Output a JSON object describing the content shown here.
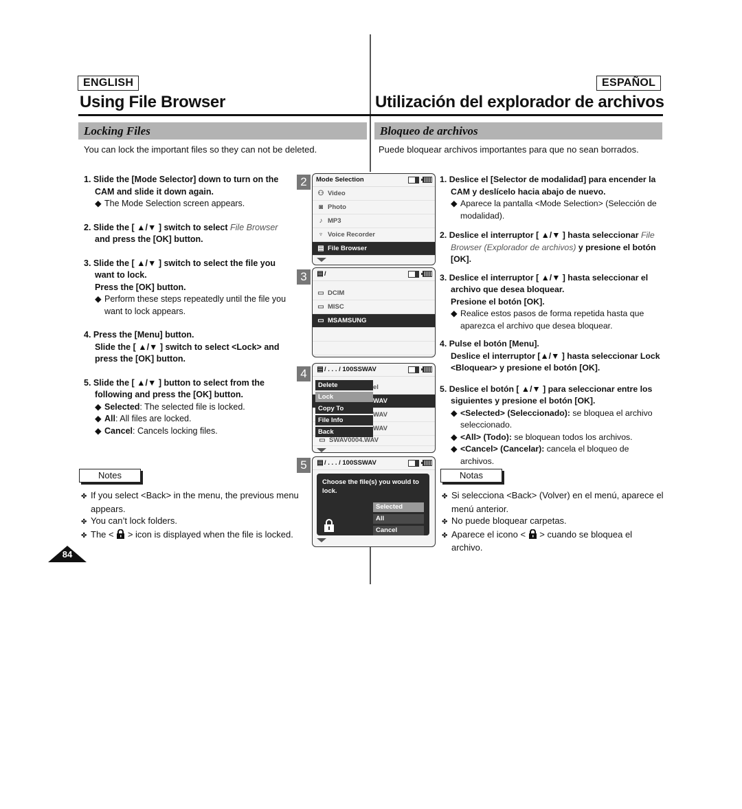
{
  "page_number": "84",
  "english": {
    "lang_label": "ENGLISH",
    "title": "Using File Browser",
    "section": "Locking Files",
    "intro": "You can lock the important files so they can not be deleted.",
    "steps": [
      {
        "num": "1.",
        "head": "Slide the [Mode Selector] down to turn on the CAM and slide it down again.",
        "bullets": [
          {
            "text": "The Mode Selection screen appears."
          }
        ]
      },
      {
        "num": "2.",
        "head_pre": "Slide the [ ▲/▼ ] switch to select ",
        "head_ital": "File Browser",
        "head_post": " and press the [OK] button.",
        "bullets": []
      },
      {
        "num": "3.",
        "head": "Slide the [ ▲/▼ ] switch to select the file you want to lock.",
        "head2": "Press the [OK] button.",
        "bullets": [
          {
            "text": "Perform these steps repeatedly until the file you want to lock appears."
          }
        ]
      },
      {
        "num": "4.",
        "head": "Press the [Menu] button.",
        "head2": "Slide the [ ▲/▼ ] switch to select <Lock> and press the [OK] button.",
        "bullets": []
      },
      {
        "num": "5.",
        "head": "Slide the [ ▲/▼ ] button to select from the following and press the [OK] button.",
        "bullets": [
          {
            "bold": "Selected",
            "text": ": The selected file is locked."
          },
          {
            "bold": "All",
            "text": ": All files are locked."
          },
          {
            "bold": "Cancel",
            "text": ": Cancels locking files."
          }
        ]
      }
    ],
    "notes_label": "Notes",
    "notes": [
      {
        "text": "If you select <Back> in the menu, the previous menu appears."
      },
      {
        "text": "You can’t lock folders."
      },
      {
        "pre": "The < ",
        "icon": "lock-icon",
        "post": " > icon is displayed when the file is locked."
      }
    ]
  },
  "spanish": {
    "lang_label": "ESPAÑOL",
    "title": "Utilización del explorador de archivos",
    "section": "Bloqueo de archivos",
    "intro": "Puede bloquear archivos importantes para que no sean borrados.",
    "steps": [
      {
        "num": "1.",
        "head": "Deslice el [Selector de modalidad] para encender la CAM y deslícelo hacia abajo de nuevo.",
        "bullets": [
          {
            "text": "Aparece la pantalla <Mode Selection> (Selección de modalidad)."
          }
        ]
      },
      {
        "num": "2.",
        "head_pre": "Deslice el interruptor [ ▲/▼ ] hasta seleccionar ",
        "head_ital": "File Browser (Explorador de archivos)",
        "head_post": " y presione el botón [OK].",
        "bullets": []
      },
      {
        "num": "3.",
        "head": "Deslice el interruptor [ ▲/▼ ] hasta seleccionar el archivo que desea bloquear.",
        "head2": "Presione el botón [OK].",
        "bullets": [
          {
            "text": "Realice estos pasos de forma repetida hasta que aparezca el archivo que desea bloquear."
          }
        ]
      },
      {
        "num": "4.",
        "head": "Pulse el botón [Menu].",
        "head2": "Deslice el interruptor [▲/▼ ] hasta seleccionar Lock <Bloquear> y presione el botón [OK].",
        "bullets": []
      },
      {
        "num": "5.",
        "head": "Deslice el botón [ ▲/▼ ] para seleccionar entre los siguientes y presione el botón [OK].",
        "bullets": [
          {
            "bold": "<Selected> (Seleccionado):",
            "text": " se bloquea el archivo seleccionado."
          },
          {
            "bold": "<All> (Todo):",
            "text": " se bloquean todos los archivos."
          },
          {
            "bold": "<Cancel> (Cancelar):",
            "text": " cancela el bloqueo de archivos."
          }
        ]
      }
    ],
    "notes_label": "Notas",
    "notes": [
      {
        "text": "Si selecciona <Back> (Volver) en el menú, aparece el menú anterior."
      },
      {
        "text": "No puede bloquear carpetas."
      },
      {
        "pre": "Aparece el icono < ",
        "icon": "lock-icon",
        "post": " > cuando se bloquea el archivo."
      }
    ]
  },
  "screens": {
    "s2": {
      "num": "2",
      "title": "Mode Selection",
      "items": [
        {
          "icon": "video-icon",
          "glyph": "🎥",
          "label": "Video"
        },
        {
          "icon": "camera-icon",
          "glyph": "📷",
          "label": "Photo"
        },
        {
          "icon": "music-note-icon",
          "glyph": "♪",
          "label": "MP3"
        },
        {
          "icon": "microphone-icon",
          "glyph": "🎙",
          "label": "Voice Recorder"
        },
        {
          "icon": "file-icon",
          "glyph": "▤",
          "label": "File Browser",
          "selected": true
        }
      ]
    },
    "s3": {
      "num": "3",
      "path": "/",
      "items": [
        {
          "label": "DCIM"
        },
        {
          "label": "MISC"
        },
        {
          "label": "MSAMSUNG",
          "selected": true
        }
      ]
    },
    "s4": {
      "num": "4",
      "path": "/ . . . / 100SSWAV",
      "list": [
        "el",
        "WAV",
        "WAV",
        "WAV",
        "SWAV0004.WAV"
      ],
      "menu": [
        {
          "label": "Delete"
        },
        {
          "label": "Lock",
          "highlighted": true
        },
        {
          "label": "Copy To"
        },
        {
          "label": "File Info"
        },
        {
          "label": "Back"
        }
      ]
    },
    "s5": {
      "num": "5",
      "path": "/ . . . / 100SSWAV",
      "message": "Choose the file(s) you would to lock.",
      "options": [
        {
          "label": "Selected",
          "highlighted": true
        },
        {
          "label": "All"
        },
        {
          "label": "Cancel"
        }
      ]
    }
  }
}
